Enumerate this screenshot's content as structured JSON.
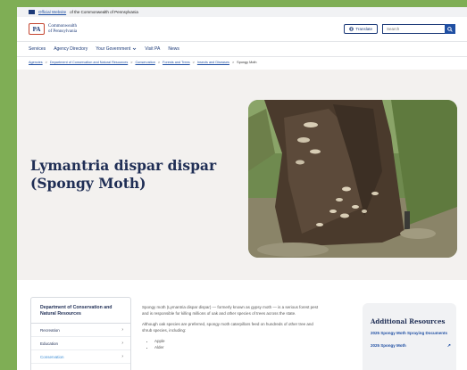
{
  "official_bar": {
    "link_text": "Official Website",
    "text": "of the Commonwealth of Pennsylvania"
  },
  "header": {
    "logo_mark": "PA",
    "logo_line1": "Commonwealth",
    "logo_line2": "of Pennsylvania",
    "translate_label": "Translate",
    "search_placeholder": "Search"
  },
  "nav": {
    "items": [
      "Services",
      "Agency Directory",
      "Your Government",
      "Visit PA",
      "News"
    ]
  },
  "breadcrumb": {
    "items": [
      "Agencies",
      "Department of Conservation and Natural Resources",
      "Conservation",
      "Forests and Trees",
      "Insects and Diseases"
    ],
    "current": "Spongy Moth",
    "separator": ">"
  },
  "hero": {
    "title": "Lymantria dispar dispar (Spongy Moth)"
  },
  "sidebar": {
    "title": "Department of Conservation and Natural Resources",
    "items": [
      "Recreation",
      "Education",
      "Conservation"
    ]
  },
  "body": {
    "p1": "Spongy moth (Lymantria dispar dispar) — formerly known as gypsy moth — is a serious forest pest and is responsible for killing millions of oak and other species of trees across the state.",
    "p2": "Although oak species are preferred, spongy moth caterpillars feed on hundreds of other tree and shrub species, including:",
    "list": [
      "Apple",
      "Alder"
    ]
  },
  "resources": {
    "title": "Additional Resources",
    "links": [
      "2025 Spongy Moth Spraying Documents",
      "2025 Spongy Moth"
    ]
  },
  "colors": {
    "primary": "#1c3a78",
    "link": "#1f4fa3",
    "hero_bg": "#f3f1ef",
    "page_bg": "#7fae55"
  }
}
